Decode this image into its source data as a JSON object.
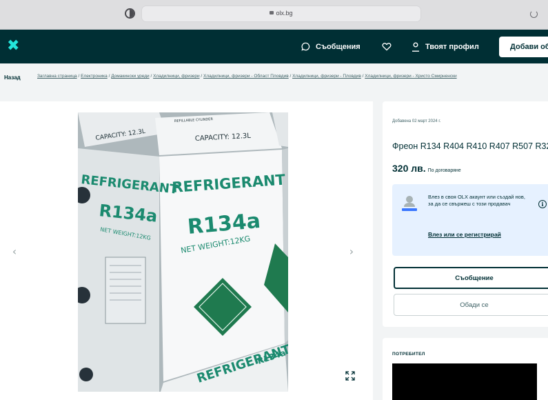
{
  "browser": {
    "url": "olx.bg"
  },
  "nav": {
    "logo_glyph": "✖",
    "messages_label": "Съобщения",
    "profile_label": "Твоят профил",
    "add_label": "Добави об"
  },
  "breadcrumb": {
    "back_label": "Назад",
    "items": [
      "Заглавна страница",
      "Електроника",
      "Домакински уреди",
      "Хладилници, фризери",
      "Хладилници, фризери - Област Пловдив",
      "Хладилници, фризери - Пловдив",
      "Хладилници, фризери - Христо Смирненски"
    ]
  },
  "gallery": {
    "prev_glyph": "‹",
    "next_glyph": "›",
    "photo_texts": {
      "brand": "REFRIGERANT",
      "model": "R134a",
      "weight": "NET WEIGHT:12KG",
      "capacity": "CAPACITY: 12.3L",
      "refill": "REFILLABLE CYLINDER"
    }
  },
  "ad": {
    "posted": "Добавена 02 март 2024 г.",
    "title": "Фреон R134 R404 R410 R407 R507 R32",
    "price": "320 лв.",
    "negotiable": "По договаряне",
    "login_prompt": "Влез в своя OLX акаунт или създай нов, за да се свържеш с този продавач",
    "login_link": "Влез или се регистрирай",
    "message_button": "Съобщение",
    "call_button": "Обади се",
    "user_label": "ПОТРЕБИТЕЛ"
  },
  "colors": {
    "nav_bg": "#002f34",
    "accent": "#23e5db",
    "login_box_bg": "#e6f1ff",
    "label_green": "#1f7a4f"
  }
}
